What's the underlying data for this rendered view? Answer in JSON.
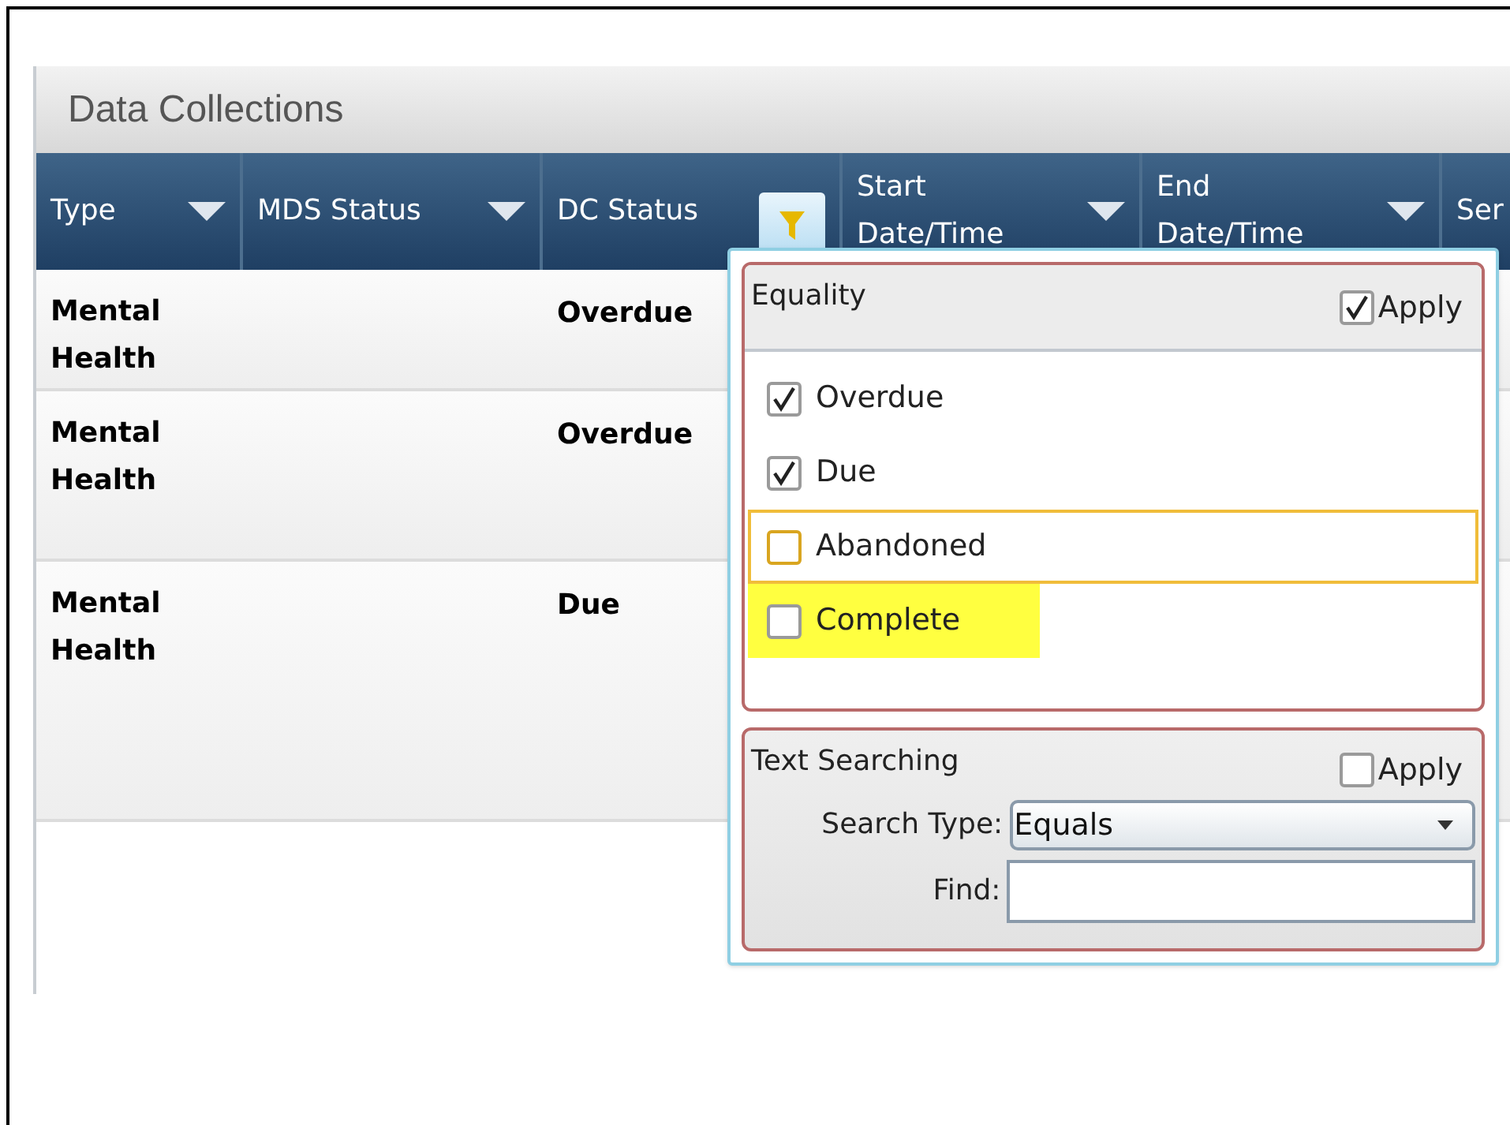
{
  "panel": {
    "title": "Data Collections"
  },
  "table": {
    "columns": [
      {
        "label": "Type",
        "filtered": false
      },
      {
        "label": "MDS Status",
        "filtered": false
      },
      {
        "label": "DC Status",
        "filtered": true
      },
      {
        "label": "Start Date/Time",
        "filtered": false
      },
      {
        "label": "End Date/Time",
        "filtered": false
      },
      {
        "label": "Ser",
        "filtered": false
      }
    ],
    "rows": [
      {
        "type": "Mental Health",
        "dc_status": "Overdue"
      },
      {
        "type": "Mental Health",
        "dc_status": "Overdue"
      },
      {
        "type": "Mental Health",
        "dc_status": "Due"
      }
    ]
  },
  "filter_popup": {
    "equality": {
      "title": "Equality",
      "apply_label": "Apply",
      "apply_checked": true,
      "options": [
        {
          "label": "Overdue",
          "checked": true,
          "focused": false,
          "highlighted": false
        },
        {
          "label": "Due",
          "checked": true,
          "focused": false,
          "highlighted": false
        },
        {
          "label": "Abandoned",
          "checked": false,
          "focused": true,
          "highlighted": false
        },
        {
          "label": "Complete",
          "checked": false,
          "focused": false,
          "highlighted": true
        }
      ]
    },
    "text_searching": {
      "title": "Text Searching",
      "apply_label": "Apply",
      "apply_checked": false,
      "search_type_label": "Search Type:",
      "search_type_value": "Equals",
      "find_label": "Find:"
    }
  }
}
